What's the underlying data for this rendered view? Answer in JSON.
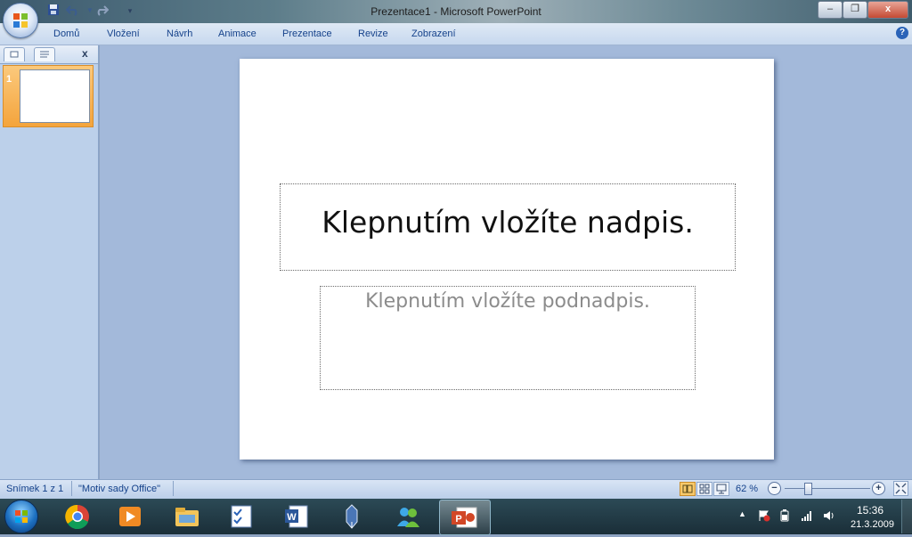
{
  "window": {
    "title": "Prezentace1  -  Microsoft PowerPoint",
    "min_label": "–",
    "max_label": "❐",
    "close_label": "x"
  },
  "quick_access": {
    "save_icon": "save-icon",
    "undo_icon": "undo-icon",
    "redo_icon": "redo-icon",
    "customize_icon": "chevron-down-icon"
  },
  "ribbon": {
    "tabs": [
      "Domů",
      "Vložení",
      "Návrh",
      "Animace",
      "Prezentace",
      "Revize",
      "Zobrazení"
    ],
    "help_label": "?"
  },
  "left_pane": {
    "close_label": "x",
    "slide_number": "1"
  },
  "slide": {
    "title_placeholder": "Klepnutím vložíte nadpis.",
    "subtitle_placeholder": "Klepnutím vložíte podnadpis."
  },
  "status": {
    "slide_counter": "Snímek 1 z 1",
    "theme": "\"Motiv sady Office\"",
    "zoom": "62 %",
    "zoom_out_label": "−",
    "zoom_in_label": "+"
  },
  "taskbar": {
    "time": "15:36",
    "date": "21.3.2009",
    "tray_arrow": "▲",
    "apps": [
      "chrome-icon",
      "media-player-icon",
      "explorer-icon",
      "task-icon",
      "word-icon",
      "pen-icon",
      "messenger-icon",
      "powerpoint-icon"
    ]
  },
  "colors": {
    "accent": "#15428b",
    "selected_thumb": "#f4a43c",
    "ribbon_bg": "#dfe9f5",
    "editor_bg": "#a3b9da"
  }
}
